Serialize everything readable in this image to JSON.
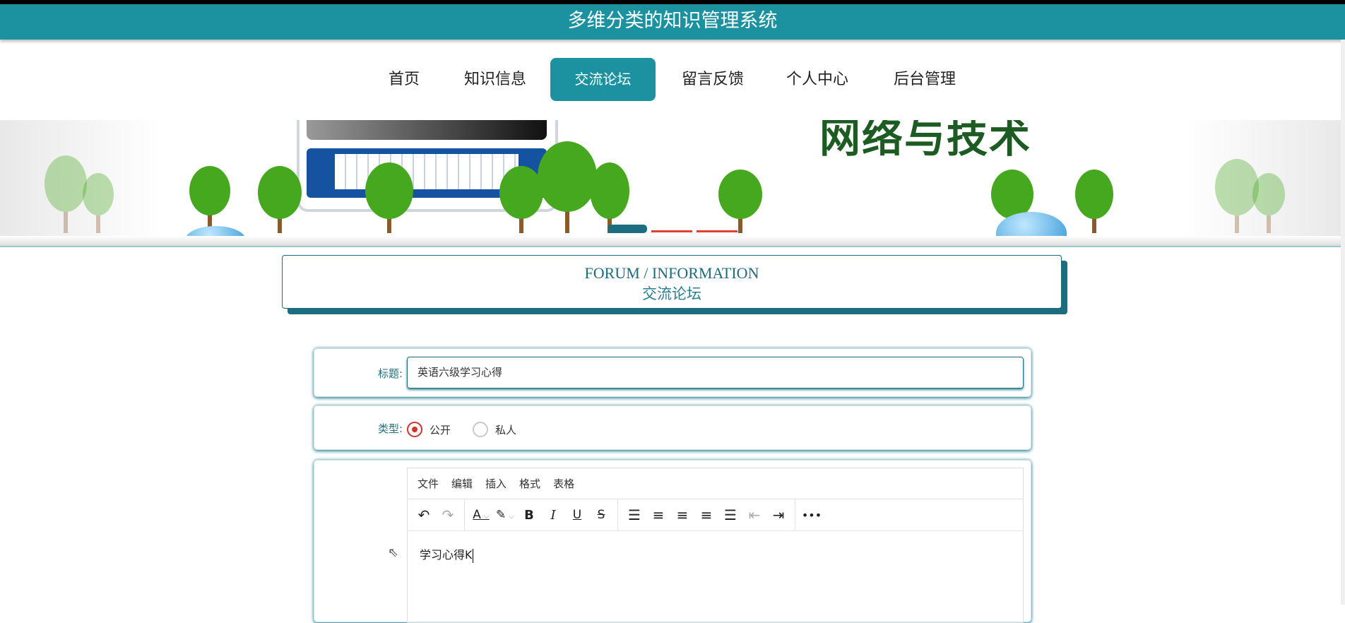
{
  "header": {
    "title": "多维分类的知识管理系统"
  },
  "nav": {
    "items": [
      {
        "label": "首页"
      },
      {
        "label": "知识信息"
      },
      {
        "label": "交流论坛",
        "active": true
      },
      {
        "label": "留言反馈"
      },
      {
        "label": "个人中心"
      },
      {
        "label": "后台管理"
      }
    ]
  },
  "banner": {
    "word": "网络与技术",
    "slides": 3,
    "active_slide": 1
  },
  "colors": {
    "primary": "#1c92a0",
    "dark": "#1c6d80",
    "radio": "#d0342c"
  },
  "section": {
    "en": "FORUM / INFORMATION",
    "cn": "交流论坛"
  },
  "form": {
    "title_label": "标题:",
    "title_value": "英语六级学习心得",
    "type_label": "类型:",
    "type_options": [
      {
        "label": "公开",
        "checked": true
      },
      {
        "label": "私人",
        "checked": false
      }
    ],
    "editor": {
      "menus": [
        "文件",
        "编辑",
        "插入",
        "格式",
        "表格"
      ],
      "toolbar_icons": [
        "undo-icon",
        "redo-icon",
        "text-color-icon",
        "highlight-icon",
        "bold-icon",
        "italic-icon",
        "underline-icon",
        "strikethrough-icon",
        "line-height-icon",
        "align-left-icon",
        "align-center-icon",
        "align-right-icon",
        "justify-icon",
        "outdent-icon",
        "indent-icon",
        "more-icon"
      ],
      "content": "学习心得K"
    }
  }
}
